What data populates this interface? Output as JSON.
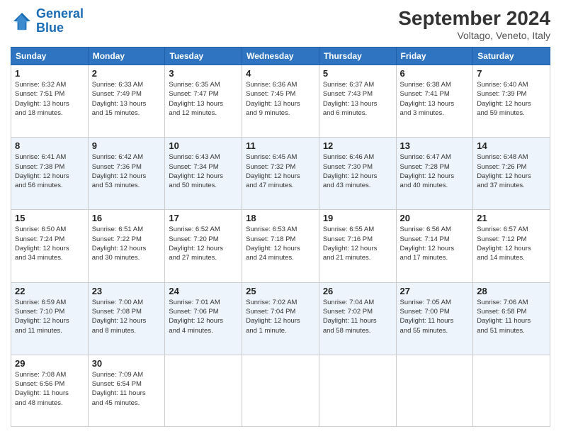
{
  "header": {
    "logo_text_general": "General",
    "logo_text_blue": "Blue",
    "month_title": "September 2024",
    "location": "Voltago, Veneto, Italy"
  },
  "weekdays": [
    "Sunday",
    "Monday",
    "Tuesday",
    "Wednesday",
    "Thursday",
    "Friday",
    "Saturday"
  ],
  "weeks": [
    [
      {
        "day": "1",
        "info": "Sunrise: 6:32 AM\nSunset: 7:51 PM\nDaylight: 13 hours\nand 18 minutes."
      },
      {
        "day": "2",
        "info": "Sunrise: 6:33 AM\nSunset: 7:49 PM\nDaylight: 13 hours\nand 15 minutes."
      },
      {
        "day": "3",
        "info": "Sunrise: 6:35 AM\nSunset: 7:47 PM\nDaylight: 13 hours\nand 12 minutes."
      },
      {
        "day": "4",
        "info": "Sunrise: 6:36 AM\nSunset: 7:45 PM\nDaylight: 13 hours\nand 9 minutes."
      },
      {
        "day": "5",
        "info": "Sunrise: 6:37 AM\nSunset: 7:43 PM\nDaylight: 13 hours\nand 6 minutes."
      },
      {
        "day": "6",
        "info": "Sunrise: 6:38 AM\nSunset: 7:41 PM\nDaylight: 13 hours\nand 3 minutes."
      },
      {
        "day": "7",
        "info": "Sunrise: 6:40 AM\nSunset: 7:39 PM\nDaylight: 12 hours\nand 59 minutes."
      }
    ],
    [
      {
        "day": "8",
        "info": "Sunrise: 6:41 AM\nSunset: 7:38 PM\nDaylight: 12 hours\nand 56 minutes."
      },
      {
        "day": "9",
        "info": "Sunrise: 6:42 AM\nSunset: 7:36 PM\nDaylight: 12 hours\nand 53 minutes."
      },
      {
        "day": "10",
        "info": "Sunrise: 6:43 AM\nSunset: 7:34 PM\nDaylight: 12 hours\nand 50 minutes."
      },
      {
        "day": "11",
        "info": "Sunrise: 6:45 AM\nSunset: 7:32 PM\nDaylight: 12 hours\nand 47 minutes."
      },
      {
        "day": "12",
        "info": "Sunrise: 6:46 AM\nSunset: 7:30 PM\nDaylight: 12 hours\nand 43 minutes."
      },
      {
        "day": "13",
        "info": "Sunrise: 6:47 AM\nSunset: 7:28 PM\nDaylight: 12 hours\nand 40 minutes."
      },
      {
        "day": "14",
        "info": "Sunrise: 6:48 AM\nSunset: 7:26 PM\nDaylight: 12 hours\nand 37 minutes."
      }
    ],
    [
      {
        "day": "15",
        "info": "Sunrise: 6:50 AM\nSunset: 7:24 PM\nDaylight: 12 hours\nand 34 minutes."
      },
      {
        "day": "16",
        "info": "Sunrise: 6:51 AM\nSunset: 7:22 PM\nDaylight: 12 hours\nand 30 minutes."
      },
      {
        "day": "17",
        "info": "Sunrise: 6:52 AM\nSunset: 7:20 PM\nDaylight: 12 hours\nand 27 minutes."
      },
      {
        "day": "18",
        "info": "Sunrise: 6:53 AM\nSunset: 7:18 PM\nDaylight: 12 hours\nand 24 minutes."
      },
      {
        "day": "19",
        "info": "Sunrise: 6:55 AM\nSunset: 7:16 PM\nDaylight: 12 hours\nand 21 minutes."
      },
      {
        "day": "20",
        "info": "Sunrise: 6:56 AM\nSunset: 7:14 PM\nDaylight: 12 hours\nand 17 minutes."
      },
      {
        "day": "21",
        "info": "Sunrise: 6:57 AM\nSunset: 7:12 PM\nDaylight: 12 hours\nand 14 minutes."
      }
    ],
    [
      {
        "day": "22",
        "info": "Sunrise: 6:59 AM\nSunset: 7:10 PM\nDaylight: 12 hours\nand 11 minutes."
      },
      {
        "day": "23",
        "info": "Sunrise: 7:00 AM\nSunset: 7:08 PM\nDaylight: 12 hours\nand 8 minutes."
      },
      {
        "day": "24",
        "info": "Sunrise: 7:01 AM\nSunset: 7:06 PM\nDaylight: 12 hours\nand 4 minutes."
      },
      {
        "day": "25",
        "info": "Sunrise: 7:02 AM\nSunset: 7:04 PM\nDaylight: 12 hours\nand 1 minute."
      },
      {
        "day": "26",
        "info": "Sunrise: 7:04 AM\nSunset: 7:02 PM\nDaylight: 11 hours\nand 58 minutes."
      },
      {
        "day": "27",
        "info": "Sunrise: 7:05 AM\nSunset: 7:00 PM\nDaylight: 11 hours\nand 55 minutes."
      },
      {
        "day": "28",
        "info": "Sunrise: 7:06 AM\nSunset: 6:58 PM\nDaylight: 11 hours\nand 51 minutes."
      }
    ],
    [
      {
        "day": "29",
        "info": "Sunrise: 7:08 AM\nSunset: 6:56 PM\nDaylight: 11 hours\nand 48 minutes."
      },
      {
        "day": "30",
        "info": "Sunrise: 7:09 AM\nSunset: 6:54 PM\nDaylight: 11 hours\nand 45 minutes."
      },
      {
        "day": "",
        "info": ""
      },
      {
        "day": "",
        "info": ""
      },
      {
        "day": "",
        "info": ""
      },
      {
        "day": "",
        "info": ""
      },
      {
        "day": "",
        "info": ""
      }
    ]
  ]
}
